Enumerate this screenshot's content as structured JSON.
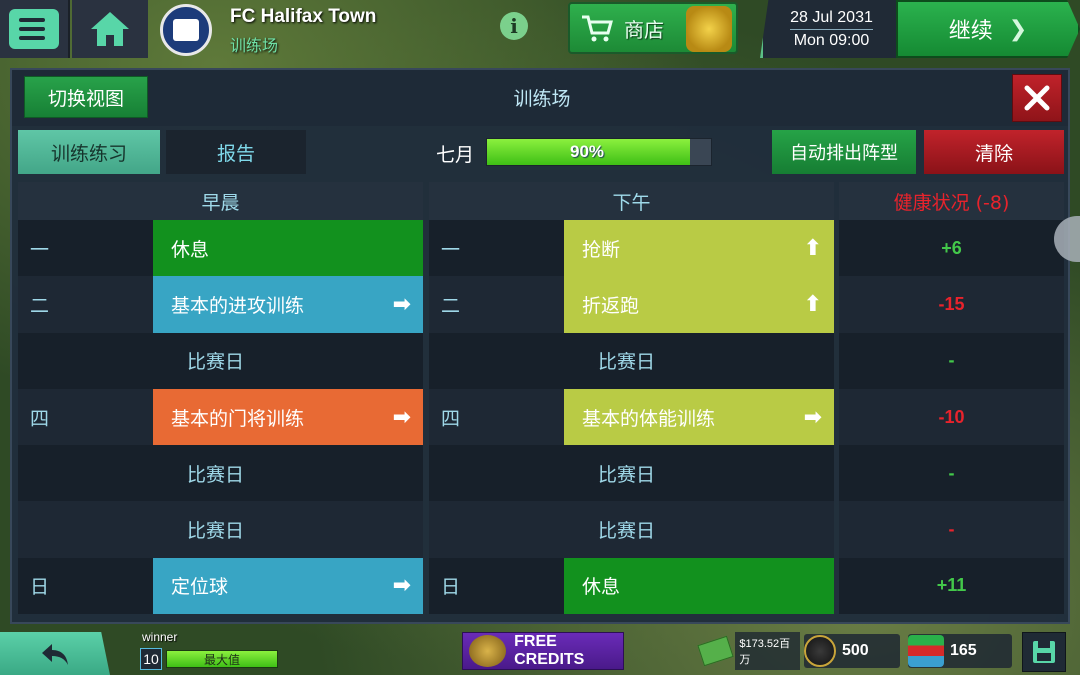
{
  "topbar": {
    "team_name": "FC Halifax Town",
    "team_sub": "训练场",
    "shop_label": "商店",
    "date_line1": "28 Jul 2031",
    "date_line2": "Mon 09:00",
    "continue_label": "继续"
  },
  "panel": {
    "switch_view_label": "切换视图",
    "title": "训练场",
    "tab_training": "训练练习",
    "tab_report": "报告",
    "month": "七月",
    "progress_text": "90%",
    "progress_value": 0.9,
    "auto_label": "自动排出阵型",
    "clear_label": "清除",
    "morning_header": "早晨",
    "afternoon_header": "下午",
    "health_header": "健康状况 (-8)"
  },
  "morning": [
    {
      "day": "一",
      "activity": "休息",
      "type": "rest",
      "arrow": ""
    },
    {
      "day": "二",
      "activity": "基本的进攻训练",
      "type": "attack",
      "arrow": "➡"
    },
    {
      "day": "",
      "activity": "比赛日",
      "type": "matchday",
      "arrow": ""
    },
    {
      "day": "四",
      "activity": "基本的门将训练",
      "type": "keeper",
      "arrow": "➡"
    },
    {
      "day": "",
      "activity": "比赛日",
      "type": "matchday",
      "arrow": ""
    },
    {
      "day": "",
      "activity": "比赛日",
      "type": "matchday",
      "arrow": ""
    },
    {
      "day": "日",
      "activity": "定位球",
      "type": "setpiece",
      "arrow": "➡"
    }
  ],
  "afternoon": [
    {
      "day": "一",
      "activity": "抢断",
      "type": "tackle",
      "arrow": "⬆"
    },
    {
      "day": "二",
      "activity": "折返跑",
      "type": "tackle",
      "arrow": "⬆"
    },
    {
      "day": "",
      "activity": "比赛日",
      "type": "matchday",
      "arrow": ""
    },
    {
      "day": "四",
      "activity": "基本的体能训练",
      "type": "fitness",
      "arrow": "➡"
    },
    {
      "day": "",
      "activity": "比赛日",
      "type": "matchday",
      "arrow": ""
    },
    {
      "day": "",
      "activity": "比赛日",
      "type": "matchday",
      "arrow": ""
    },
    {
      "day": "日",
      "activity": "休息",
      "type": "rest",
      "arrow": ""
    }
  ],
  "health": [
    {
      "value": "+6",
      "kind": "pos"
    },
    {
      "value": "-15",
      "kind": "neg"
    },
    {
      "value": "-",
      "kind": "pos"
    },
    {
      "value": "-10",
      "kind": "neg"
    },
    {
      "value": "-",
      "kind": "pos"
    },
    {
      "value": "-",
      "kind": "neg"
    },
    {
      "value": "+11",
      "kind": "pos"
    }
  ],
  "bottombar": {
    "player_name": "winner",
    "level": "10",
    "xp_label": "最大值",
    "free_credits": "FREE CREDITS",
    "cash": "$173.52百万",
    "coins": "500",
    "chips": "165"
  },
  "colors": {
    "accent_green": "#1d8a36",
    "danger_red": "#c1232b",
    "teal": "#58d6a8"
  }
}
